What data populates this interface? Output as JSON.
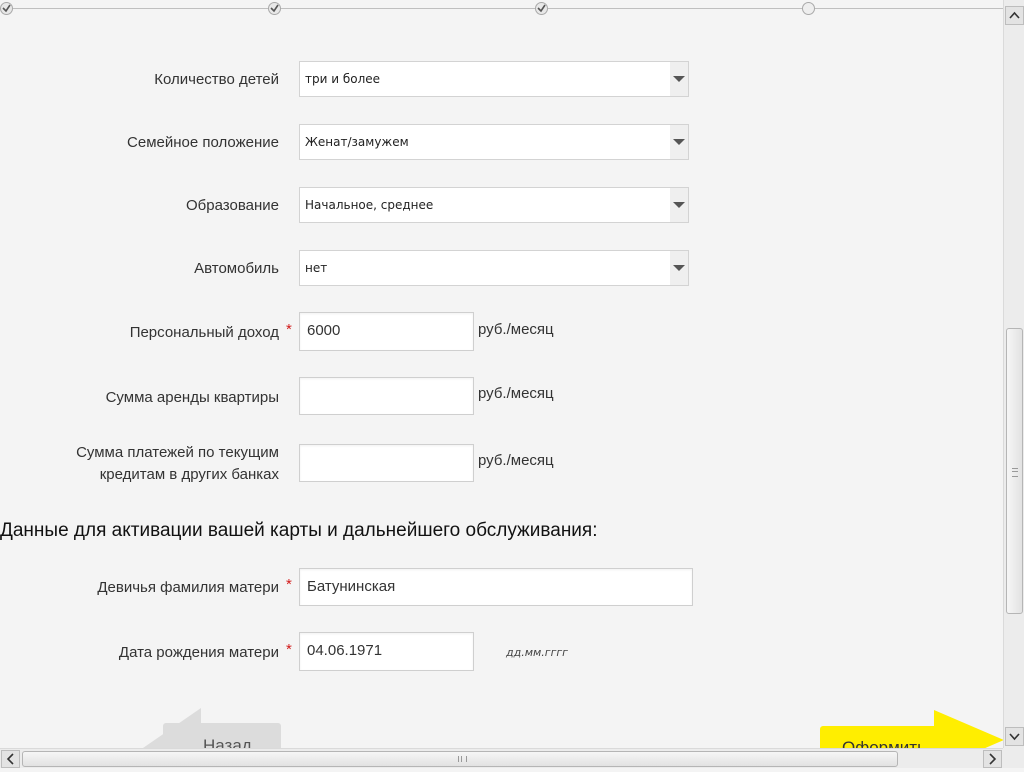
{
  "form": {
    "children_count": {
      "label": "Количество детей",
      "value": "три и более"
    },
    "marital_status": {
      "label": "Семейное положение",
      "value": "Женат/замужем"
    },
    "education": {
      "label": "Образование",
      "value": "Начальное, среднее"
    },
    "car": {
      "label": "Автомобиль",
      "value": "нет"
    },
    "personal_income": {
      "label": "Персональный доход",
      "required_mark": "*",
      "value": "6000",
      "unit": "руб./месяц"
    },
    "rent_amount": {
      "label": "Сумма аренды квартиры",
      "value": "",
      "unit": "руб./месяц"
    },
    "loan_payments": {
      "label_line1": "Сумма платежей по текущим",
      "label_line2": "кредитам в других банках",
      "value": "",
      "unit": "руб./месяц"
    }
  },
  "activation_section": {
    "title": "Данные для активации вашей карты и дальнейшего обслуживания:",
    "mother_maiden_name": {
      "label": "Девичья фамилия матери",
      "required_mark": "*",
      "value": "Батунинская"
    },
    "mother_birth_date": {
      "label": "Дата рождения матери",
      "required_mark": "*",
      "value": "04.06.1971",
      "hint": "дд.мм.гггг"
    }
  },
  "buttons": {
    "back_label": "Назад",
    "submit_label": "Оформить"
  },
  "progress_steps": [
    {
      "state": "done"
    },
    {
      "state": "done"
    },
    {
      "state": "done"
    },
    {
      "state": "pending"
    }
  ],
  "colors": {
    "submit": "#ffee00",
    "required": "#d21b1b",
    "back": "#dcdcdc"
  }
}
